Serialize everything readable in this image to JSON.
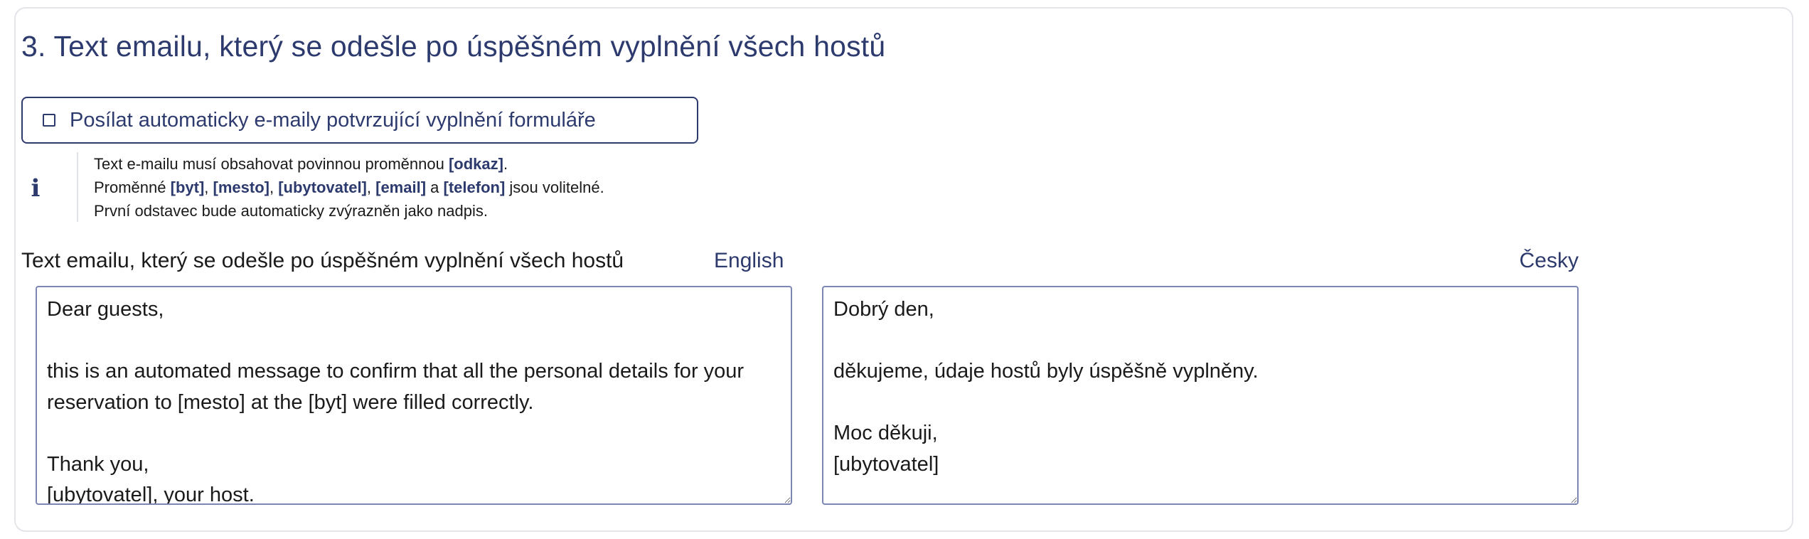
{
  "section": {
    "title": "3. Text emailu, který se odešle po úspěšném vyplnění všech hostů"
  },
  "auto_email": {
    "label": "Posílat automaticky e-maily potvrzující vyplnění formuláře",
    "checked": false
  },
  "info": {
    "icon": "info-icon",
    "line1_pre": "Text e-mailu musí obsahovat povinnou proměnnou ",
    "line1_var": "[odkaz]",
    "line1_post": ".",
    "line2_pre": "Proměnné ",
    "line2_v1": "[byt]",
    "line2_s1": ", ",
    "line2_v2": "[mesto]",
    "line2_s2": ", ",
    "line2_v3": "[ubytovatel]",
    "line2_s3": ", ",
    "line2_v4": "[email]",
    "line2_s4": " a ",
    "line2_v5": "[telefon]",
    "line2_post": " jsou volitelné.",
    "line3": "První odstavec bude automaticky zvýrazněn jako nadpis."
  },
  "field": {
    "label": "Text emailu, který se odešle po úspěšném vyplnění všech hostů",
    "lang_en": "English",
    "lang_cs": "Česky",
    "text_en": "Dear guests,\n\nthis is an automated message to confirm that all the personal details for your reservation to [mesto] at the [byt] were filled correctly.\n\nThank you,\n[ubytovatel], your host.",
    "text_cs": "Dobrý den,\n\nděkujeme, údaje hostů byly úspěšně vyplněny.\n\nMoc děkuji,\n[ubytovatel]"
  },
  "colors": {
    "accent": "#2d3a6e",
    "border": "#7b86b5",
    "card_border": "#e3e5ea"
  }
}
